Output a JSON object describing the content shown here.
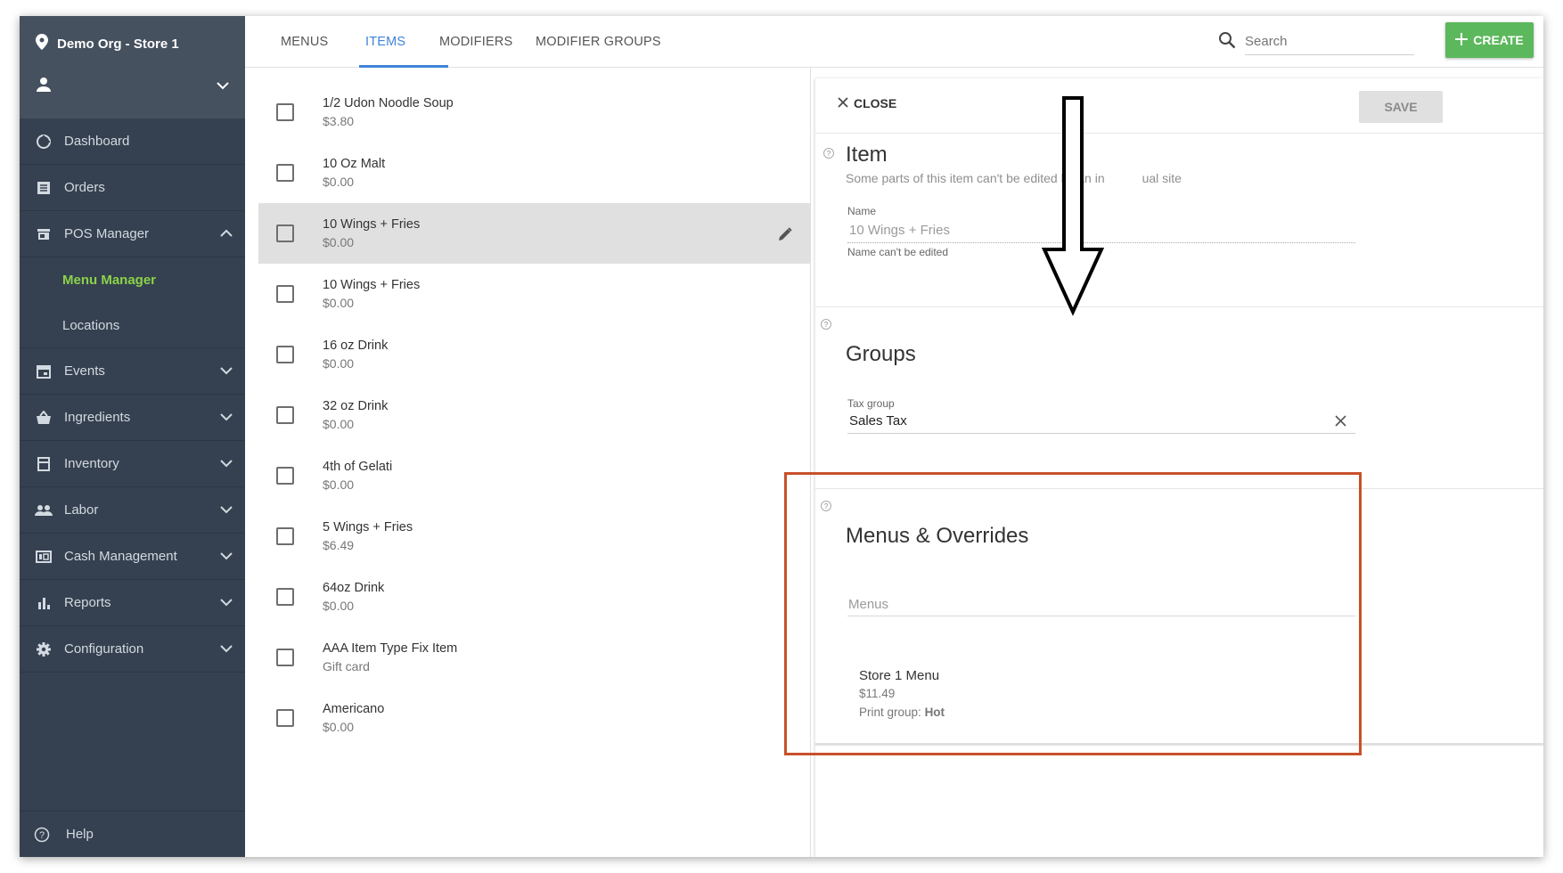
{
  "sidebar": {
    "org_label": "Demo Org - Store 1",
    "items": [
      {
        "label": "Dashboard",
        "icon": "dashboard-icon",
        "chevron": ""
      },
      {
        "label": "Orders",
        "icon": "orders-icon",
        "chevron": ""
      },
      {
        "label": "POS Manager",
        "icon": "store-icon",
        "chevron": "up"
      }
    ],
    "sub_items": [
      {
        "label": "Menu Manager",
        "active": true
      },
      {
        "label": "Locations",
        "active": false
      }
    ],
    "items_after": [
      {
        "label": "Events",
        "icon": "calendar-icon"
      },
      {
        "label": "Ingredients",
        "icon": "basket-icon"
      },
      {
        "label": "Inventory",
        "icon": "inventory-icon"
      },
      {
        "label": "Labor",
        "icon": "people-icon"
      },
      {
        "label": "Cash Management",
        "icon": "cash-icon"
      },
      {
        "label": "Reports",
        "icon": "bar-chart-icon"
      },
      {
        "label": "Configuration",
        "icon": "gear-icon"
      }
    ],
    "help_label": "Help"
  },
  "topbar": {
    "tabs": [
      {
        "label": "MENUS",
        "active": false
      },
      {
        "label": "ITEMS",
        "active": true
      },
      {
        "label": "MODIFIERS",
        "active": false
      },
      {
        "label": "MODIFIER GROUPS",
        "active": false
      }
    ],
    "search_placeholder": "Search",
    "create_label": "CREATE"
  },
  "list": {
    "items": [
      {
        "name": "1/2 Udon Noodle Soup",
        "price": "$3.80",
        "selected": false
      },
      {
        "name": "10 Oz Malt",
        "price": "$0.00",
        "selected": false
      },
      {
        "name": "10 Wings + Fries",
        "price": "$0.00",
        "selected": true
      },
      {
        "name": "10 Wings + Fries",
        "price": "$0.00",
        "selected": false
      },
      {
        "name": "16 oz Drink",
        "price": "$0.00",
        "selected": false
      },
      {
        "name": "32 oz Drink",
        "price": "$0.00",
        "selected": false
      },
      {
        "name": "4th of Gelati",
        "price": "$0.00",
        "selected": false
      },
      {
        "name": "5 Wings + Fries",
        "price": "$6.49",
        "selected": false
      },
      {
        "name": "64oz Drink",
        "price": "$0.00",
        "selected": false
      },
      {
        "name": "AAA Item Type Fix Item",
        "price": "Gift card",
        "selected": false
      },
      {
        "name": "Americano",
        "price": "$0.00",
        "selected": false
      }
    ]
  },
  "detail": {
    "close_label": "CLOSE",
    "save_label": "SAVE",
    "item_section": {
      "title": "Item",
      "subtitle_before": "Some parts of this item can't be edited by an in",
      "subtitle_after": "ual site",
      "name_label": "Name",
      "name_value": "10 Wings + Fries",
      "name_helper": "Name can't be edited"
    },
    "groups_section": {
      "title": "Groups",
      "tax_label": "Tax group",
      "tax_value": "Sales Tax"
    },
    "menus_section": {
      "title": "Menus & Overrides",
      "menus_placeholder": "Menus",
      "menu_entry": {
        "name": "Store 1 Menu",
        "price": "$11.49",
        "print_group_label": "Print group:",
        "print_group_value": "Hot"
      }
    }
  },
  "colors": {
    "sidebar_bg": "#354150",
    "accent_blue": "#3f84d8",
    "active_green": "#8bd24a",
    "create_green": "#5cb85c",
    "highlight_red": "#c8502a"
  }
}
